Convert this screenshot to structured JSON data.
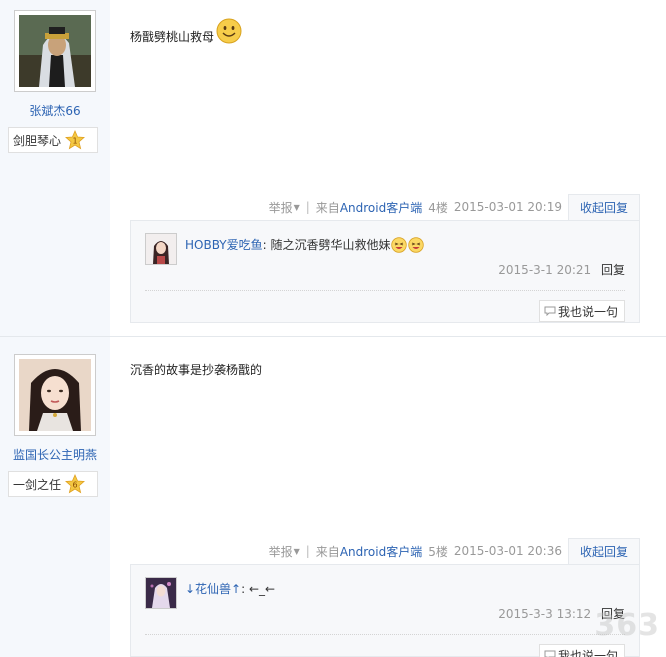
{
  "colors": {
    "link": "#2d64b3",
    "meta": "#999999",
    "sidebar_bg": "#f5f8fc",
    "reply_bg": "#f7f8fa"
  },
  "posts": [
    {
      "author": {
        "name": "张斌杰66",
        "level_title": "剑胆琴心",
        "level": "1"
      },
      "content": "杨戬劈桃山救母",
      "content_icon": "smile-emoji-icon",
      "tail": {
        "report": "举报",
        "source_prefix": "来自",
        "client": "Android客户端",
        "floor": "4楼",
        "time": "2015-03-01 20:19",
        "collapse": "收起回复"
      },
      "comments": [
        {
          "user": "HOBBY爱吃鱼",
          "text": ": 随之沉香劈华山救他妹",
          "emoji": [
            "laugh-emoji-icon",
            "laugh-emoji-icon"
          ],
          "time": "2015-3-1 20:21",
          "reply": "回复"
        }
      ],
      "say_button": "我也说一句"
    },
    {
      "author": {
        "name": "监国长公主明燕",
        "level_title": "一剑之任",
        "level": "6"
      },
      "content": "沉香的故事是抄袭杨戬的",
      "tail": {
        "report": "举报",
        "source_prefix": "来自",
        "client": "Android客户端",
        "floor": "5楼",
        "time": "2015-03-01 20:36",
        "collapse": "收起回复"
      },
      "comments": [
        {
          "user": "↓花仙兽↑",
          "text": ": ←_←",
          "time": "2015-3-3 13:12",
          "reply": "回复"
        }
      ],
      "say_button": "我也说一句"
    }
  ],
  "watermark": "363"
}
